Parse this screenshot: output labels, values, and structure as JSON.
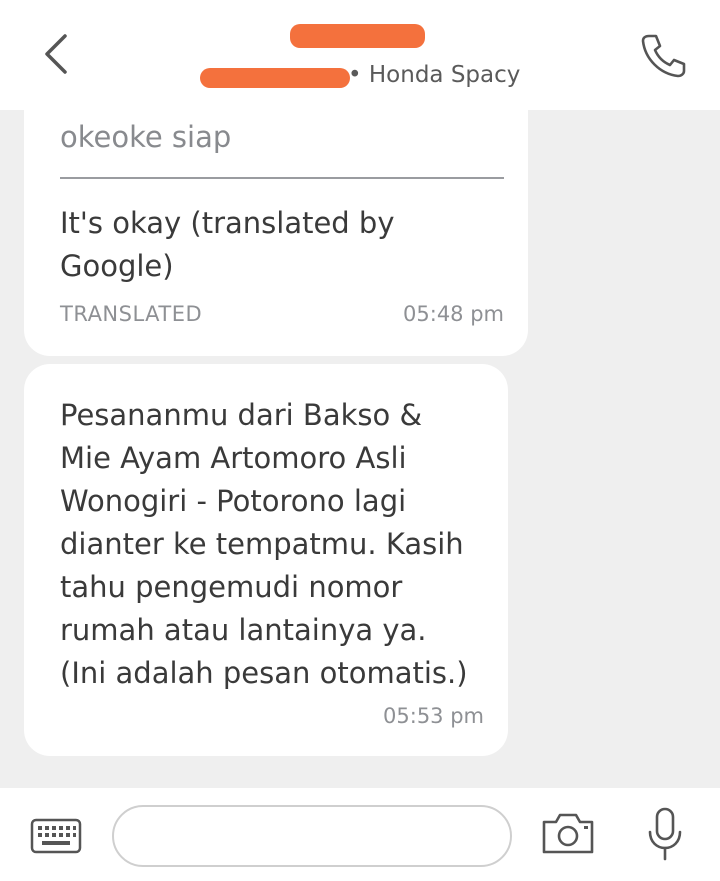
{
  "header": {
    "subtitle_vehicle": "• Honda Spacy"
  },
  "messages": [
    {
      "original_text": "okeoke siap",
      "translated_text": "It's okay (translated by Google)",
      "tag": "TRANSLATED",
      "time": "05:48 pm"
    },
    {
      "text": "Pesananmu dari Bakso & Mie Ayam Artomoro Asli Wonogiri - Potorono lagi dianter ke tempatmu. Kasih tahu pengemudi nomor rumah atau lantainya ya. (Ini adalah pesan otomatis.)",
      "time": "05:53 pm"
    }
  ],
  "composer": {
    "input_value": "",
    "input_placeholder": ""
  },
  "icons": {
    "back": "chevron-left-icon",
    "call": "phone-icon",
    "keyboard": "keyboard-icon",
    "camera": "camera-icon",
    "mic": "microphone-icon"
  },
  "colors": {
    "redaction": "#f4713d",
    "chat_background": "#efefef",
    "bubble": "#ffffff"
  }
}
